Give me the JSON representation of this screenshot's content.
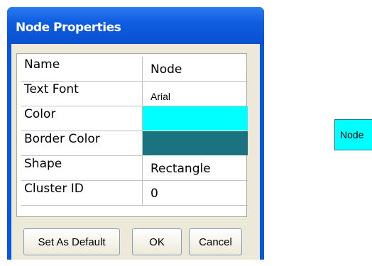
{
  "dialog": {
    "title": "Node Properties"
  },
  "properties": [
    {
      "label": "Name",
      "value": "Node"
    },
    {
      "label": "Text Font",
      "value": "Arial"
    },
    {
      "label": "Color",
      "value": "",
      "swatch": "#00ffff"
    },
    {
      "label": "Border Color",
      "value": "",
      "swatch": "#1b737f"
    },
    {
      "label": "Shape",
      "value": "Rectangle"
    },
    {
      "label": "Cluster ID",
      "value": "0"
    }
  ],
  "buttons": {
    "set_default": "Set As Default",
    "ok": "OK",
    "cancel": "Cancel"
  },
  "canvas": {
    "node_label": "Node",
    "node_fill": "#00ffff",
    "node_border": "#1b737f"
  }
}
